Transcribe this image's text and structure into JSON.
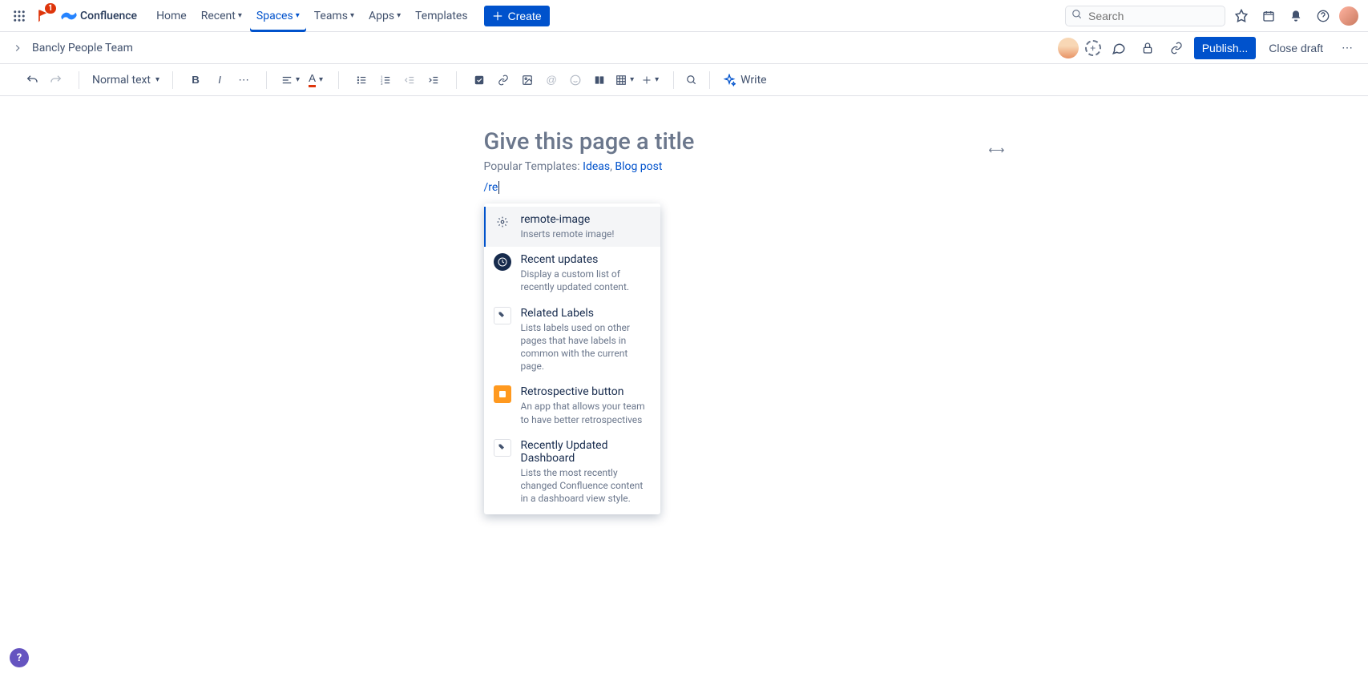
{
  "nav": {
    "product": "Confluence",
    "notif_count": "1",
    "items": [
      "Home",
      "Recent",
      "Spaces",
      "Teams",
      "Apps",
      "Templates"
    ],
    "active_index": 2,
    "create": "Create",
    "search_placeholder": "Search"
  },
  "breadcrumb": {
    "space": "Bancly People Team",
    "publish": "Publish...",
    "close": "Close draft"
  },
  "toolbar": {
    "text_style": "Normal text",
    "write": "Write"
  },
  "editor": {
    "title_placeholder": "Give this page a title",
    "templates_label": "Popular Templates:",
    "template_links": [
      "Ideas",
      "Blog post"
    ],
    "slash_input": "/re"
  },
  "dropdown": [
    {
      "icon": "gear",
      "title": "remote-image",
      "desc": "Inserts remote image!"
    },
    {
      "icon": "clock",
      "title": "Recent updates",
      "desc": "Display a custom list of recently updated content."
    },
    {
      "icon": "tag",
      "title": "Related Labels",
      "desc": "Lists labels used on other pages that have labels in common with the current page."
    },
    {
      "icon": "retro",
      "title": "Retrospective button",
      "desc": "An app that allows your team to have better retrospectives"
    },
    {
      "icon": "tag",
      "title": "Recently Updated Dashboard",
      "desc": "Lists the most recently changed Confluence content in a dashboard view style."
    }
  ]
}
